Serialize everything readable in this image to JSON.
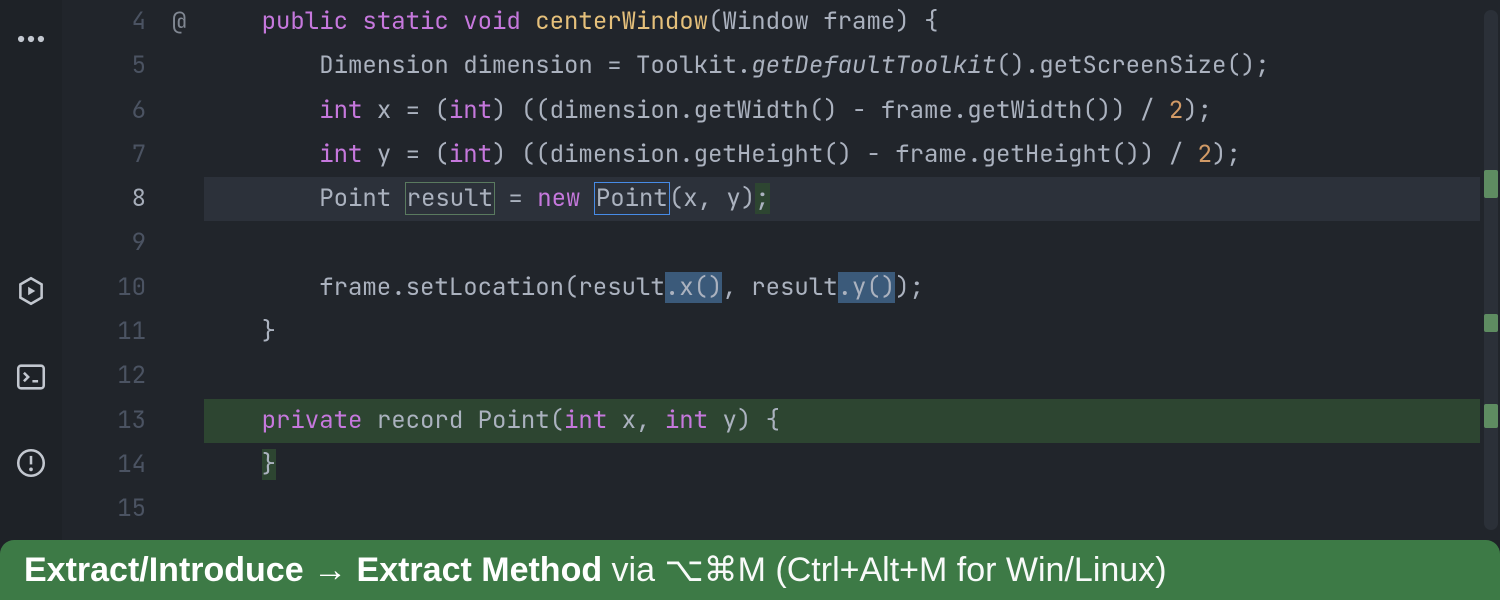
{
  "gutter": {
    "annotation_line4": "@"
  },
  "lines": [
    {
      "no": 4,
      "tokens": [
        [
          "kw",
          "public "
        ],
        [
          "kw",
          "static "
        ],
        [
          "kw",
          "void "
        ],
        [
          "mname",
          "centerWindow"
        ],
        [
          "punc",
          "("
        ],
        [
          "type",
          "Window frame"
        ],
        [
          "punc",
          ") {"
        ]
      ]
    },
    {
      "no": 5,
      "tokens": [
        [
          "",
          "    Dimension dimension = Toolkit."
        ],
        [
          "italic",
          "getDefaultToolkit"
        ],
        [
          "",
          "().getScreenSize();"
        ]
      ]
    },
    {
      "no": 6,
      "tokens": [
        [
          "",
          "    "
        ],
        [
          "kw",
          "int"
        ],
        [
          "",
          " x = ("
        ],
        [
          "kw",
          "int"
        ],
        [
          "",
          ") ((dimension.getWidth() - frame.getWidth()) / "
        ],
        [
          "num",
          "2"
        ],
        [
          "",
          ");"
        ]
      ]
    },
    {
      "no": 7,
      "tokens": [
        [
          "",
          "    "
        ],
        [
          "kw",
          "int"
        ],
        [
          "",
          " y = ("
        ],
        [
          "kw",
          "int"
        ],
        [
          "",
          ") ((dimension.getHeight() - frame.getHeight()) / "
        ],
        [
          "num",
          "2"
        ],
        [
          "",
          ");"
        ]
      ]
    },
    {
      "no": 8,
      "current": true,
      "tokens": [
        [
          "",
          "    Point "
        ],
        [
          "boxA",
          "result"
        ],
        [
          "",
          " = "
        ],
        [
          "kw",
          "new "
        ],
        [
          "boxB",
          "Point"
        ],
        [
          "",
          "(x, y)"
        ],
        [
          "hl-green",
          ";"
        ]
      ]
    },
    {
      "no": 9,
      "tokens": []
    },
    {
      "no": 10,
      "tokens": [
        [
          "",
          "    frame.setLocation(result"
        ],
        [
          "hl-sel",
          ".x()"
        ],
        [
          "",
          ", result"
        ],
        [
          "hl-sel",
          ".y()"
        ],
        [
          "",
          ");"
        ]
      ]
    },
    {
      "no": 11,
      "tokens": [
        [
          "",
          "}"
        ]
      ]
    },
    {
      "no": 12,
      "tokens": []
    },
    {
      "no": 13,
      "hlrow": true,
      "tokens": [
        [
          "kw",
          "private"
        ],
        [
          "",
          " record Point("
        ],
        [
          "kw",
          "int"
        ],
        [
          "",
          " x, "
        ],
        [
          "kw",
          "int"
        ],
        [
          "",
          " y) {"
        ]
      ]
    },
    {
      "no": 14,
      "tokens": [
        [
          "hl-green",
          "}"
        ]
      ]
    },
    {
      "no": 15,
      "tokens": []
    }
  ],
  "hint": {
    "bold1": "Extract/Introduce → Extract Method",
    "via": " via ",
    "shortcut_mac": "⌥⌘M",
    "rest": " (Ctrl+Alt+M for Win/Linux)"
  }
}
